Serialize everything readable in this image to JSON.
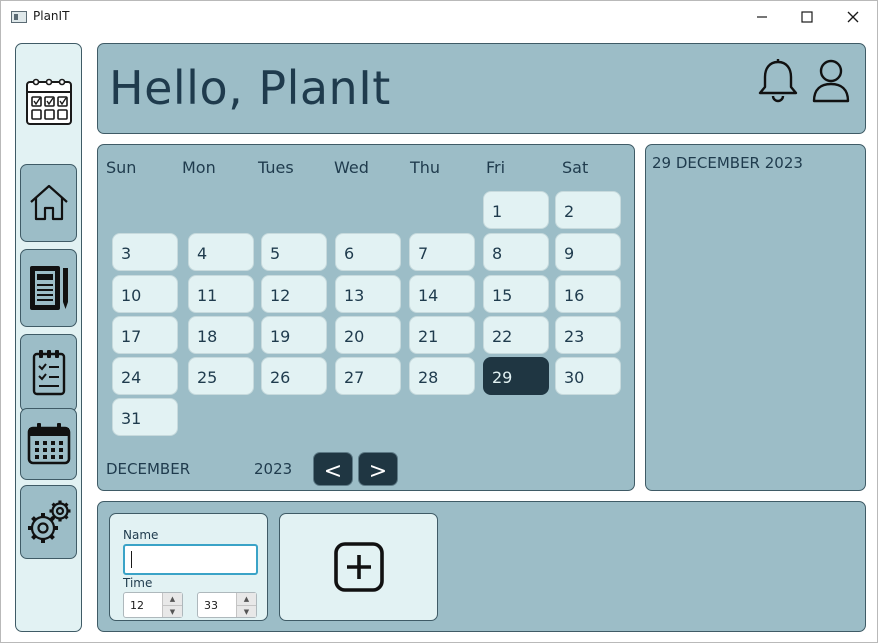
{
  "window": {
    "title": "PlanIT",
    "controls": {
      "minimize": "—",
      "maximize": "☐",
      "close": "✕"
    }
  },
  "header": {
    "greeting": "Hello, PlanIt"
  },
  "sidebar": {
    "items": [
      {
        "name": "home",
        "icon": "home-icon"
      },
      {
        "name": "notes",
        "icon": "notebook-icon"
      },
      {
        "name": "tasks",
        "icon": "checklist-icon"
      },
      {
        "name": "calendar",
        "icon": "calendar-icon"
      },
      {
        "name": "settings",
        "icon": "gear-icon"
      }
    ]
  },
  "calendar": {
    "weekdays": [
      "Sun",
      "Mon",
      "Tues",
      "Wed",
      "Thu",
      "Fri",
      "Sat"
    ],
    "first_weekday_index": 5,
    "days": [
      "1",
      "2",
      "3",
      "4",
      "5",
      "6",
      "7",
      "8",
      "9",
      "10",
      "11",
      "12",
      "13",
      "14",
      "15",
      "16",
      "17",
      "18",
      "19",
      "20",
      "21",
      "22",
      "23",
      "24",
      "25",
      "26",
      "27",
      "28",
      "29",
      "30",
      "31"
    ],
    "selected_day": "29",
    "month": "DECEMBER",
    "year": "2023",
    "prev_label": "<",
    "next_label": ">"
  },
  "detail": {
    "date_heading": "29 DECEMBER 2023"
  },
  "form": {
    "name_label": "Name",
    "name_value": "",
    "time_label": "Time",
    "hour_value": "12",
    "minute_value": "33"
  },
  "colors": {
    "panel": "#9cbdc7",
    "card": "#e2f2f3",
    "dark": "#1f3642",
    "text": "#1f3b4d"
  }
}
